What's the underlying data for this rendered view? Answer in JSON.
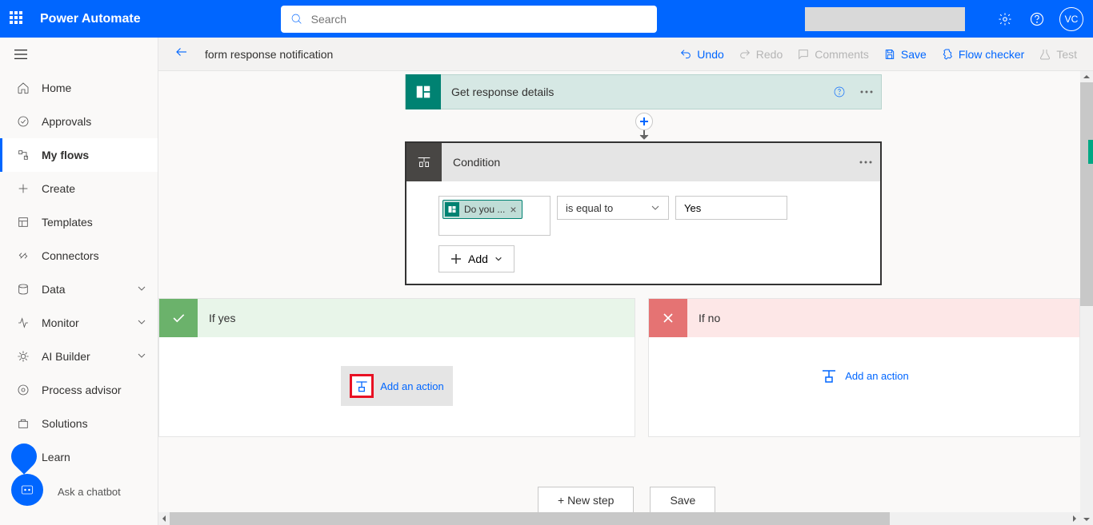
{
  "header": {
    "app_title": "Power Automate",
    "search_placeholder": "Search",
    "avatar_initials": "VC"
  },
  "nav": {
    "items": [
      {
        "label": "Home"
      },
      {
        "label": "Approvals"
      },
      {
        "label": "My flows"
      },
      {
        "label": "Create"
      },
      {
        "label": "Templates"
      },
      {
        "label": "Connectors"
      },
      {
        "label": "Data"
      },
      {
        "label": "Monitor"
      },
      {
        "label": "AI Builder"
      },
      {
        "label": "Process advisor"
      },
      {
        "label": "Solutions"
      },
      {
        "label": "Learn"
      }
    ],
    "ask_chatbot": "Ask a chatbot"
  },
  "toolbar": {
    "flow_title": "form response notification",
    "undo": "Undo",
    "redo": "Redo",
    "comments": "Comments",
    "save": "Save",
    "flow_checker": "Flow checker",
    "test": "Test"
  },
  "cards": {
    "get_response": "Get response details",
    "condition": "Condition",
    "condition_token": "Do you ...",
    "condition_operator": "is equal to",
    "condition_value": "Yes",
    "add_row": "Add",
    "if_yes": "If yes",
    "if_no": "If no",
    "add_action": "Add an action"
  },
  "bottom": {
    "new_step": "+ New step",
    "save": "Save"
  }
}
